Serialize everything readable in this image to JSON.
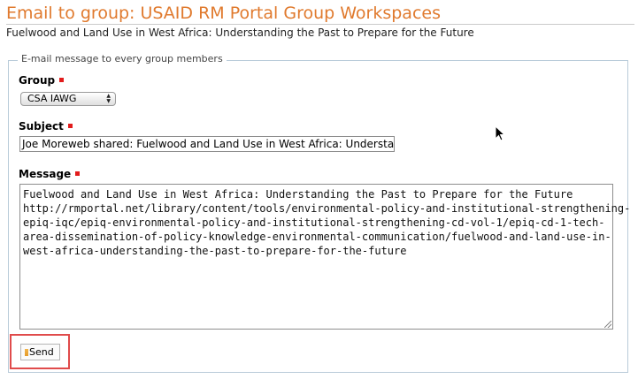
{
  "page": {
    "title": "Email to group: USAID RM Portal Group Workspaces",
    "subtitle": "Fuelwood and Land Use in West Africa: Understanding the Past to Prepare for the Future"
  },
  "form": {
    "legend": "E-mail message to every group members",
    "group": {
      "label": "Group",
      "selected": "CSA IAWG"
    },
    "subject": {
      "label": "Subject",
      "value": "Joe Moreweb shared: Fuelwood and Land Use in West Africa: Understanding the Past to Prepare for the Future"
    },
    "message": {
      "label": "Message",
      "value": "Fuelwood and Land Use in West Africa: Understanding the Past to Prepare for the Future\nhttp://rmportal.net/library/content/tools/environmental-policy-and-institutional-strengthening-\nepiq-iqc/epiq-environmental-policy-and-institutional-strengthening-cd-vol-1/epiq-cd-1-tech-\narea-dissemination-of-policy-knowledge-environmental-communication/fuelwood-and-land-use-in-\nwest-africa-understanding-the-past-to-prepare-for-the-future"
    },
    "send_label": "Send"
  },
  "colors": {
    "title": "#e07a2e",
    "required_marker": "#e21c1c",
    "highlight": "#e04b4b",
    "fieldset_border": "#b9cbd9"
  },
  "icons": {
    "required": "required-marker-icon",
    "send": "send-icon",
    "select": "chevron-updown-icon",
    "cursor": "mouse-cursor-icon"
  }
}
